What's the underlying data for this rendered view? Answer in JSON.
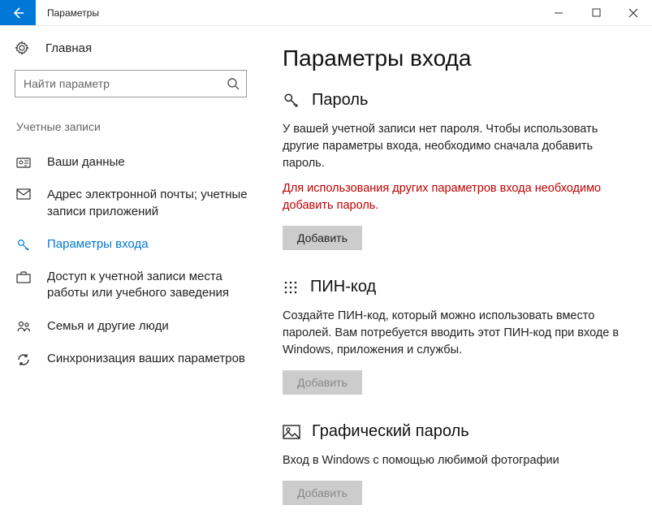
{
  "window": {
    "title": "Параметры"
  },
  "sidebar": {
    "home_label": "Главная",
    "search_placeholder": "Найти параметр",
    "group_header": "Учетные записи",
    "items": [
      {
        "label": "Ваши данные"
      },
      {
        "label": "Адрес электронной почты; учетные записи приложений"
      },
      {
        "label": "Параметры входа"
      },
      {
        "label": "Доступ к учетной записи места работы или учебного заведения"
      },
      {
        "label": "Семья и другие люди"
      },
      {
        "label": "Синхронизация ваших параметров"
      }
    ]
  },
  "page": {
    "title": "Параметры входа",
    "password": {
      "heading": "Пароль",
      "desc": "У вашей учетной записи нет пароля. Чтобы использовать другие параметры входа, необходимо сначала добавить пароль.",
      "warning": "Для использования других параметров входа необходимо добавить пароль.",
      "button": "Добавить"
    },
    "pin": {
      "heading": "ПИН-код",
      "desc": "Создайте ПИН-код, который можно использовать вместо паролей. Вам потребуется вводить этот ПИН-код при входе в Windows, приложения и службы.",
      "button": "Добавить"
    },
    "picture": {
      "heading": "Графический пароль",
      "desc": "Вход в Windows с помощью любимой фотографии",
      "button": "Добавить"
    }
  }
}
